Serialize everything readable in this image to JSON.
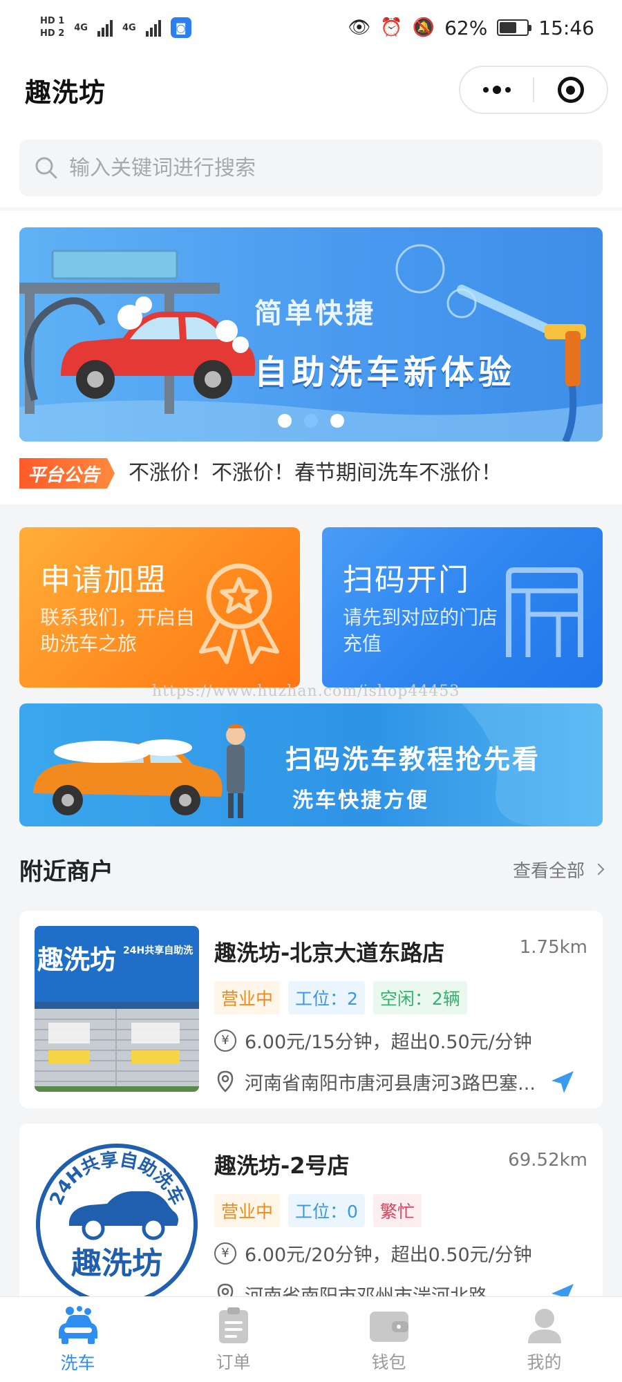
{
  "status_bar": {
    "left_labels": [
      "HD 1",
      "HD 2",
      "4G",
      "4G"
    ],
    "battery": "62%",
    "time": "15:46"
  },
  "nav": {
    "title": "趣洗坊"
  },
  "search": {
    "placeholder": "输入关键词进行搜索"
  },
  "banner": {
    "line1": "简单快捷",
    "line2": "自助洗车新体验",
    "slides": 3,
    "active_slide": 2
  },
  "notice": {
    "tag": "平台公告",
    "text": "不涨价！不涨价！春节期间洗车不涨价！"
  },
  "cards": {
    "join": {
      "title": "申请加盟",
      "subtitle": "联系我们，开启自助洗车之旅"
    },
    "scan": {
      "title": "扫码开门",
      "subtitle": "请先到对应的门店充值"
    }
  },
  "watermark": "https://www.huzhan.com/ishop44453",
  "tutorial": {
    "line1": "扫码洗车教程抢先看",
    "line2": "洗车快捷方便"
  },
  "nearby": {
    "title": "附近商户",
    "more": "查看全部"
  },
  "merchants": [
    {
      "name": "趣洗坊-北京大道东路店",
      "distance": "1.75km",
      "status": "营业中",
      "slots": "工位：2",
      "availability": "空闲：2辆",
      "price": "6.00元/15分钟，超出0.50元/分钟",
      "address": "河南省南阳市唐河县唐河3路巴塞...",
      "photo": {
        "sign": "趣洗坊",
        "sign2": "24H共享自助洗"
      }
    },
    {
      "name": "趣洗坊-2号店",
      "distance": "69.52km",
      "status": "营业中",
      "slots": "工位：0",
      "availability": "繁忙",
      "price": "6.00元/20分钟，超出0.50元/分钟",
      "address": "河南省南阳市邓州市湍河北路",
      "logo": {
        "ring": "24H共享自助洗车",
        "brand": "趣洗坊"
      }
    }
  ],
  "tabs": [
    {
      "label": "洗车",
      "icon": "car-wash-icon",
      "active": true
    },
    {
      "label": "订单",
      "icon": "order-icon",
      "active": false
    },
    {
      "label": "钱包",
      "icon": "wallet-icon",
      "active": false
    },
    {
      "label": "我的",
      "icon": "profile-icon",
      "active": false
    }
  ],
  "colors": {
    "primary_blue": "#2d8df0",
    "orange": "#ff8a1e",
    "tag_open": "#f08a1a",
    "tag_slot": "#3a96e8",
    "tag_free": "#33b36b",
    "tag_busy": "#e0405a"
  }
}
